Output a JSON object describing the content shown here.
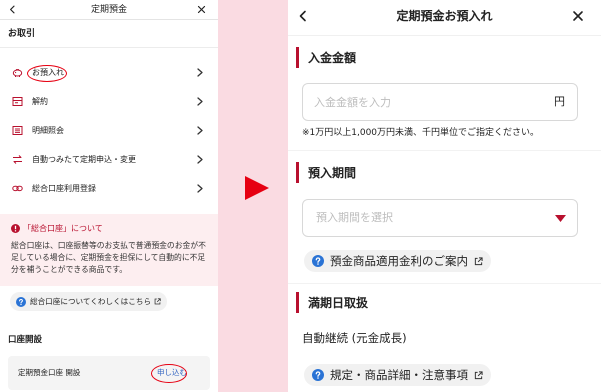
{
  "colors": {
    "accent_red": "#b8102e",
    "arrow_red": "#e60012",
    "highlight_red": "#e60012",
    "gap_pink": "#fadbe2",
    "notice_bg": "#fdeef0",
    "link_blue": "#2f62c0",
    "help_blue": "#2a73d5"
  },
  "left": {
    "header": {
      "title": "定期預金",
      "back_icon": "chevron-left-icon",
      "close_icon": "close-icon"
    },
    "transactions_heading": "お取引",
    "menu": [
      {
        "label": "お預入れ",
        "icon": "deposit-icon",
        "highlighted": true
      },
      {
        "label": "解約",
        "icon": "withdraw-icon",
        "highlighted": false
      },
      {
        "label": "明細照会",
        "icon": "statement-icon",
        "highlighted": false
      },
      {
        "label": "自動つみたて定期申込・変更",
        "icon": "exchange-arrows-icon",
        "highlighted": false
      },
      {
        "label": "総合口座利用登録",
        "icon": "link-icon",
        "highlighted": false
      }
    ],
    "notice": {
      "icon": "exclamation-icon",
      "title": "「総合口座」について",
      "body": "総合口座は、口座振替等のお支払で普通預金のお金が不足している場合に、定期預金を担保にして自動的に不足分を補うことができる商品です。"
    },
    "notice_link": "総合口座についてくわしくはこちら",
    "open_heading": "口座開設",
    "open_card": {
      "label": "定期預金口座 開設",
      "action": "申し込む",
      "highlighted": true
    }
  },
  "right": {
    "header": {
      "title": "定期預金お預入れ",
      "back_icon": "chevron-left-icon",
      "close_icon": "close-icon"
    },
    "amount": {
      "heading": "入金金額",
      "placeholder": "入金金額を入力",
      "value": "",
      "unit": "円",
      "note": "※1万円以上1,000万円未満、千円単位でご指定ください。"
    },
    "term": {
      "heading": "預入期間",
      "placeholder": "預入期間を選択",
      "rate_link": "預金商品適用金利のご案内"
    },
    "maturity": {
      "heading": "満期日取扱",
      "value": "自動継続 (元金成長)",
      "terms_link": "規定・商品詳細・注意事項"
    }
  }
}
